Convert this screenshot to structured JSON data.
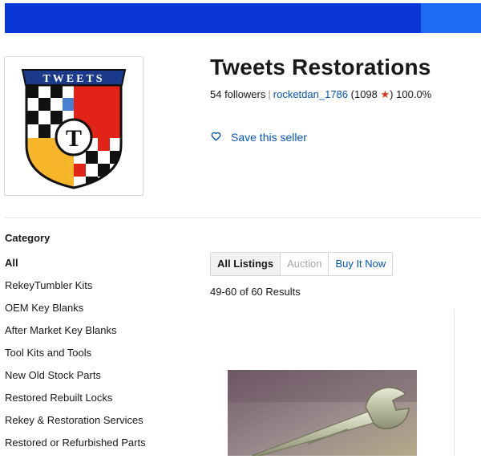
{
  "header": {
    "banner_color": "#0a37d6",
    "banner_accent": "#1b6cf2"
  },
  "seller": {
    "name": "Tweets Restorations",
    "followers": "54 followers",
    "username": "rocketdan_1786",
    "feedback_open": "(1098",
    "feedback_close": ")",
    "positive": "100.0%",
    "save_label": "Save this seller",
    "logo_text": "TWEETS",
    "logo_letter": "T"
  },
  "category": {
    "heading": "Category",
    "items": [
      "All",
      "RekeyTumbler Kits",
      "OEM Key Blanks",
      "After Market Key Blanks",
      "Tool Kits and Tools",
      "New Old Stock Parts",
      "Restored Rebuilt Locks",
      "Rekey & Restoration Services",
      "Restored or Refurbished Parts"
    ]
  },
  "listing_tabs": {
    "all": "All Listings",
    "auction": "Auction",
    "buy_now": "Buy It Now"
  },
  "results_text": "49-60 of 60 Results",
  "icons": {
    "save": "heart-outline-icon",
    "star": "star-icon"
  }
}
